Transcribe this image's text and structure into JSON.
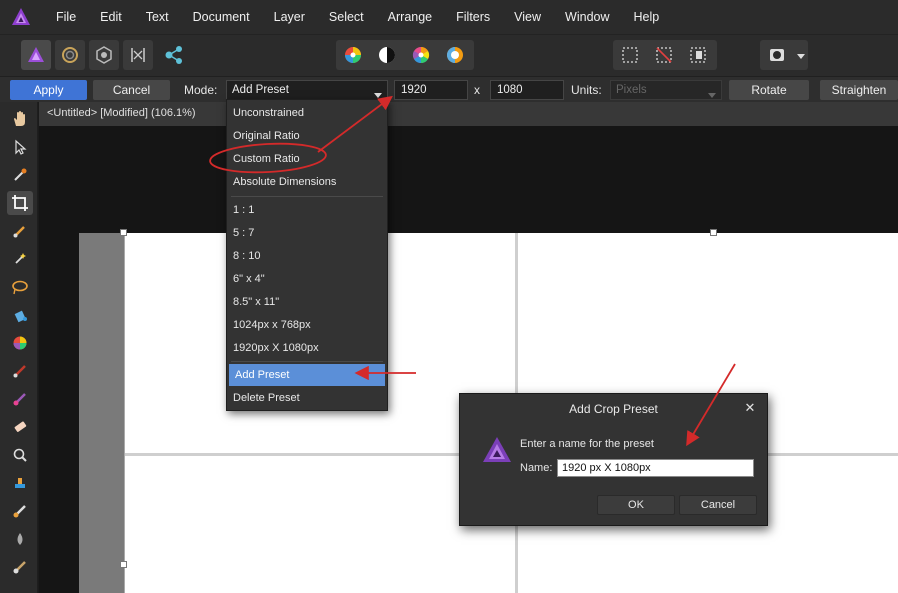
{
  "menubar": {
    "items": [
      "File",
      "Edit",
      "Text",
      "Document",
      "Layer",
      "Select",
      "Arrange",
      "Filters",
      "View",
      "Window",
      "Help"
    ]
  },
  "context_toolbar": {
    "apply_label": "Apply",
    "cancel_label": "Cancel",
    "mode_label": "Mode:",
    "mode_value": "Add Preset",
    "width_value": "1920",
    "times_label": "x",
    "height_value": "1080",
    "units_label": "Units:",
    "units_value": "Pixels",
    "rotate_label": "Rotate",
    "straighten_label": "Straighten"
  },
  "document": {
    "tab_title": "<Untitled> [Modified] (106.1%)"
  },
  "mode_dropdown": {
    "items": [
      "Unconstrained",
      "Original Ratio",
      "Custom Ratio",
      "Absolute Dimensions",
      "1 : 1",
      "5 : 7",
      "8 : 10",
      "6\" x 4\"",
      "8.5\" x 11\"",
      "1024px x 768px",
      "1920px X 1080px",
      "Add Preset",
      "Delete Preset"
    ],
    "highlighted": "Add Preset",
    "circled": "Custom Ratio"
  },
  "dialog": {
    "title": "Add Crop Preset",
    "close_glyph": "✕",
    "prompt": "Enter a name for the preset",
    "name_label": "Name:",
    "name_value": "1920 px X 1080px",
    "ok_label": "OK",
    "cancel_label": "Cancel"
  },
  "colors": {
    "accent": "#3f74d6",
    "highlight": "#5b8fd8",
    "annotation": "#d42a2a",
    "logo": "#8e3fcf"
  }
}
